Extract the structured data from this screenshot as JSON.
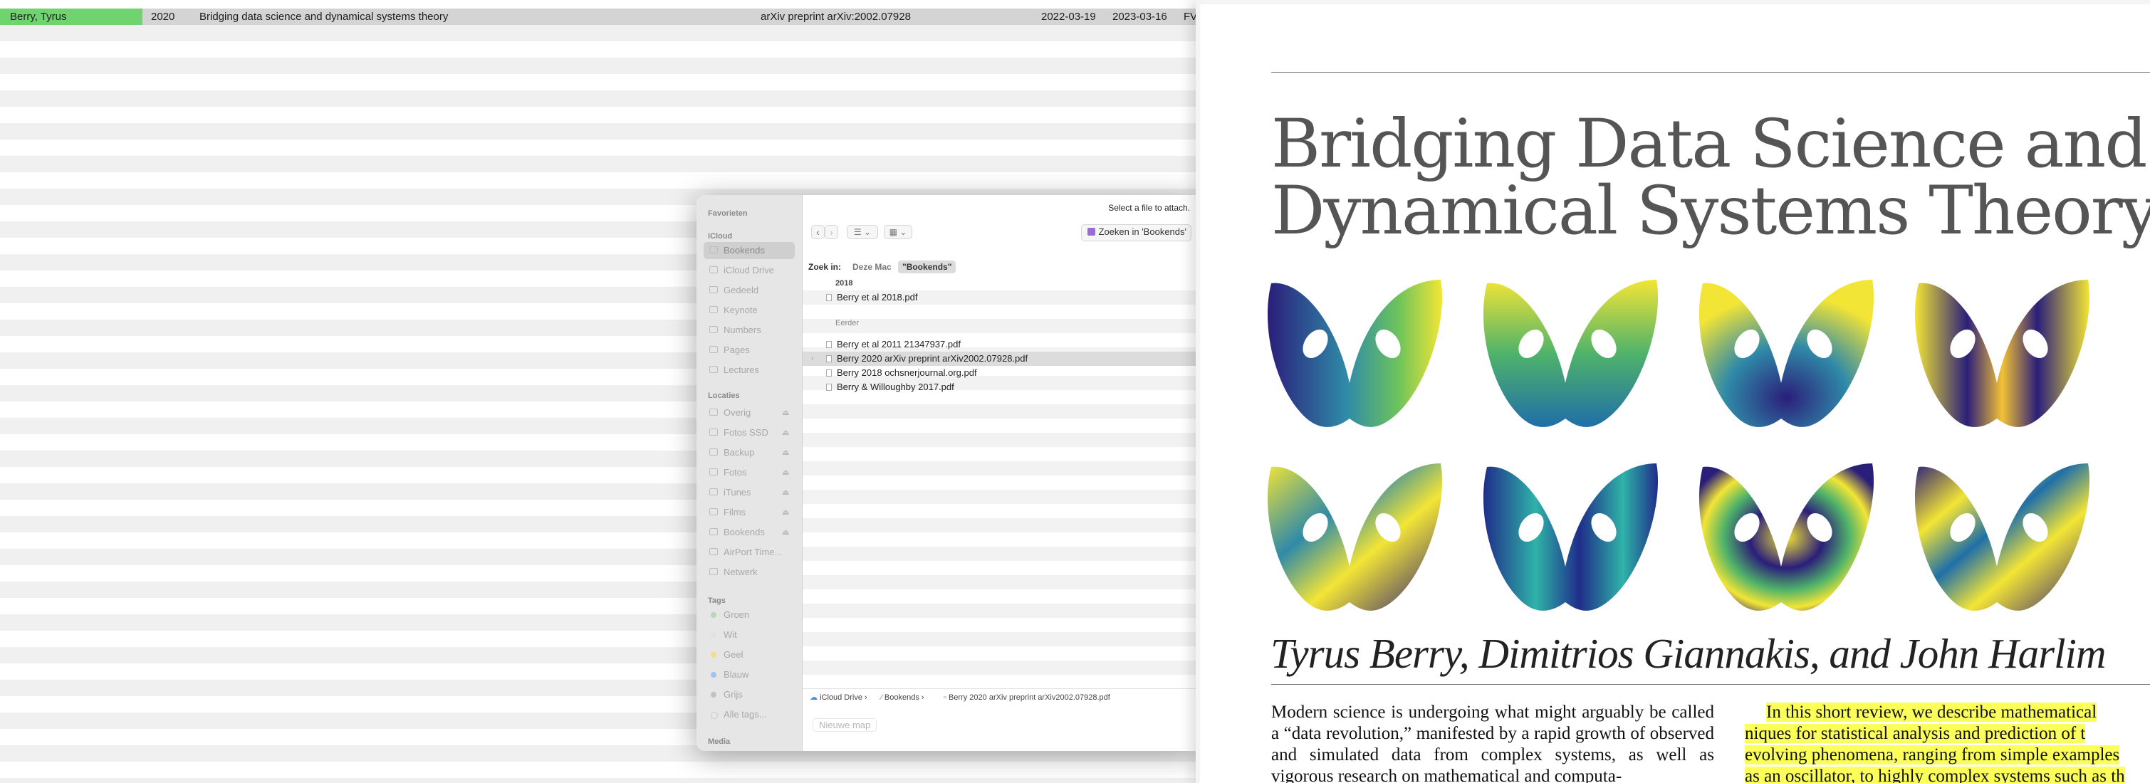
{
  "reference_list": {
    "selected_row": {
      "author": "Berry, Tyrus",
      "year": "2020",
      "title": "Bridging data science and dynamical systems theory",
      "journal": "arXiv preprint arXiv:2002.07928",
      "date_added": "2022-03-19",
      "date_modified": "2023-03-16",
      "extra": "FV"
    },
    "colors": {
      "author_highlight": "#6fd36f"
    }
  },
  "file_dialog": {
    "prompt": "Select a file to attach.",
    "sidebar": {
      "favorites_header": "Favorieten",
      "icloud_header": "iCloud",
      "icloud_items": [
        "Bookends",
        "iCloud Drive",
        "Gedeeld",
        "Keynote",
        "Numbers",
        "Pages",
        "Lectures"
      ],
      "locations_header": "Locaties",
      "location_items": [
        "Overig",
        "Fotos SSD",
        "Backup",
        "Fotos",
        "iTunes",
        "Films",
        "Bookends",
        "AirPort Time...",
        "Netwerk"
      ],
      "tags_header": "Tags",
      "tag_items": [
        {
          "label": "Groen",
          "color": "#b9d7b9"
        },
        {
          "label": "Wit",
          "color": "#e2e2e2"
        },
        {
          "label": "Geel",
          "color": "#f5dc8a"
        },
        {
          "label": "Blauw",
          "color": "#9fc3ee"
        },
        {
          "label": "Grijs",
          "color": "#c2c2c2"
        },
        {
          "label": "Alle tags...",
          "color": ""
        }
      ],
      "media_header": "Media"
    },
    "toolbar": {
      "back_icon": "‹",
      "forward_icon": "›",
      "list_view_icon": "☰ ⌄",
      "grid_view_icon": "▦ ⌄",
      "search_scope_label": "Zoeken in 'Bookends'"
    },
    "scope_bar": {
      "label": "Zoek in:",
      "option_mac": "Deze Mac",
      "option_current": "\"Bookends\""
    },
    "groups": [
      {
        "header": "2018",
        "files": [
          {
            "name": "Berry et al 2018.pdf",
            "selected": false
          }
        ]
      },
      {
        "header": "Eerder",
        "files": [
          {
            "name": "Berry et al 2011 21347937.pdf",
            "selected": false
          },
          {
            "name": "Berry 2020 arXiv preprint arXiv2002.07928.pdf",
            "selected": true
          },
          {
            "name": "Berry 2018 ochsnerjournal.org.pdf",
            "selected": false
          },
          {
            "name": "Berry & Willoughby 2017.pdf",
            "selected": false
          }
        ]
      }
    ],
    "path_bar": [
      "iCloud Drive",
      "Bookends",
      "Berry 2020 arXiv preprint arXiv2002.07928.pdf"
    ],
    "new_folder_label": "Nieuwe map"
  },
  "pdf_preview": {
    "title_line1": "Bridging Data Science and",
    "title_line2": "Dynamical Systems Theory",
    "authors": "Tyrus Berry, Dimitrios Giannakis, and John Harlim",
    "abstract_left": "Modern science is undergoing what might arguably be called a “data revolution,” manifested by a rapid growth of observed and simulated data from complex systems, as well as vigorous research on mathematical and computa-",
    "abstract_right_line1": "In this short review, we describe mathematical",
    "abstract_right_line2": "niques for statistical analysis and prediction of t",
    "abstract_right_line3": "evolving phenomena, ranging from simple examples",
    "abstract_right_line4": "as an oscillator, to highly complex systems such as th",
    "highlight_color": "#fcff5a",
    "figure": {
      "description_icon": "lorenz-attractor-eigenfunction-plots",
      "panels": 8,
      "palette": [
        "#2b1e7a",
        "#2f5fa8",
        "#1f9e8a",
        "#6dc45b",
        "#f3e535"
      ]
    }
  }
}
